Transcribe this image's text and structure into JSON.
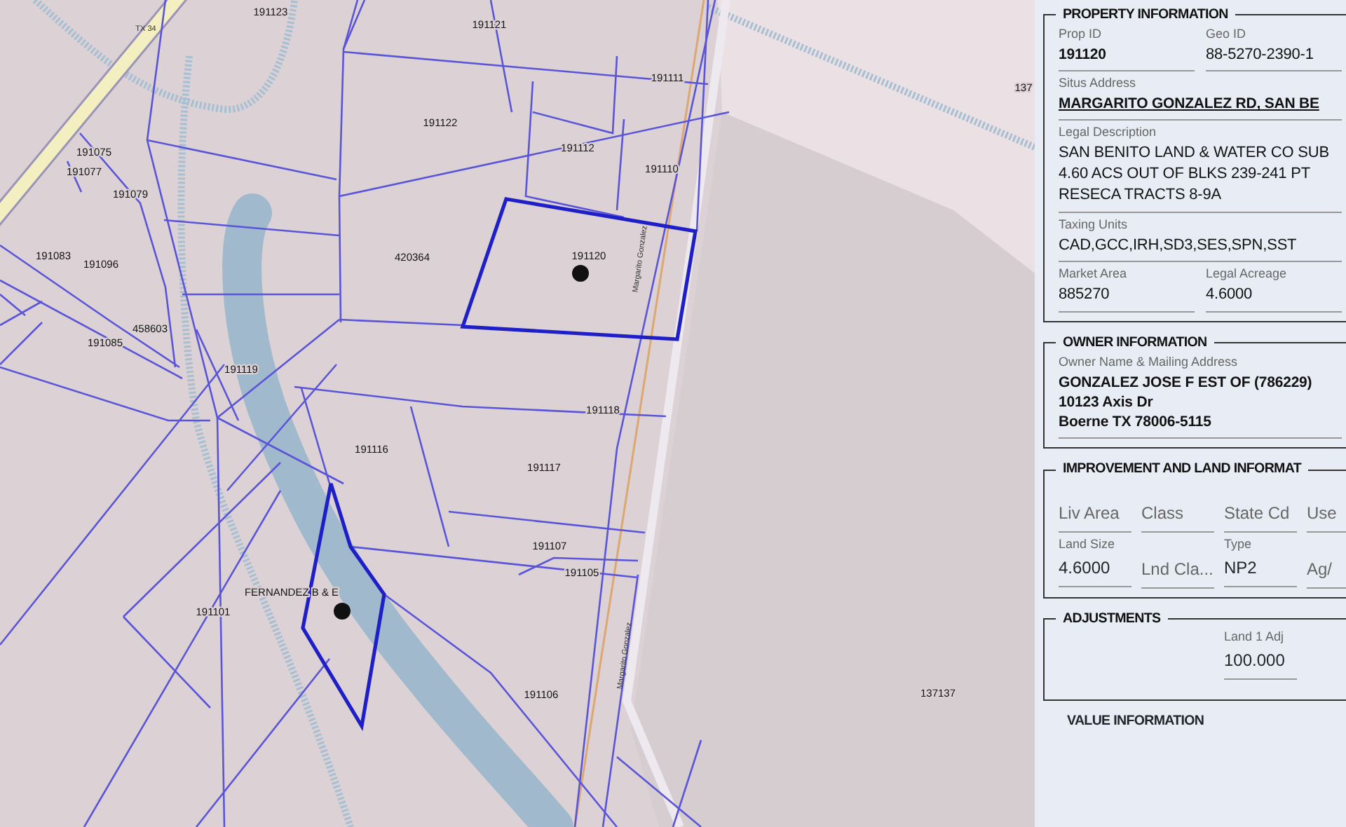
{
  "map": {
    "road_labels": [
      "TX 34",
      "Margarito Gonzalez",
      "Margarito Gonzalez"
    ],
    "parcel_labels": [
      "191123",
      "191121",
      "191111",
      "137",
      "191075",
      "191122",
      "191077",
      "191112",
      "191079",
      "191110",
      "191083",
      "191096",
      "420364",
      "191120",
      "458603",
      "191085",
      "191119",
      "191118",
      "191116",
      "191117",
      "191107",
      "191105",
      "FERNANDEZ B & E",
      "191101",
      "191106",
      "137137"
    ]
  },
  "panel": {
    "sections": [
      {
        "kind": "fields",
        "title": "PROPERTY INFORMATION",
        "rows": [
          [
            {
              "label": "Prop ID",
              "value": "191120"
            },
            {
              "label": "Geo ID",
              "value": "88-5270-2390-1"
            }
          ],
          [
            {
              "label": "Situs Address",
              "value": "MARGARITO GONZALEZ RD, SAN BE"
            }
          ],
          [
            {
              "label": "Legal Description",
              "lines": [
                "SAN BENITO LAND & WATER CO SUB",
                "4.60 ACS OUT OF BLKS 239-241 PT",
                "RESECA TRACTS 8-9A"
              ]
            }
          ],
          [
            {
              "label": "Taxing Units",
              "value": "CAD,GCC,IRH,SD3,SES,SPN,SST"
            }
          ],
          [
            {
              "label": "Market Area",
              "value": "885270"
            },
            {
              "label": "Legal Acreage",
              "value": "4.6000"
            }
          ]
        ]
      },
      {
        "kind": "fields",
        "title": "OWNER INFORMATION",
        "rows": [
          [
            {
              "label": "Owner Name & Mailing Address",
              "lines": [
                "GONZALEZ JOSE F EST OF (786229)",
                "10123 Axis Dr",
                "Boerne TX 78006-5115"
              ]
            }
          ]
        ]
      },
      {
        "kind": "grid",
        "title": "IMPROVEMENT AND LAND INFORMAT",
        "rows": [
          [
            {
              "placeholder": "Liv Area"
            },
            {
              "placeholder": "Class"
            },
            {
              "placeholder": "State Cd"
            },
            {
              "placeholder": "Use"
            }
          ],
          [
            {
              "label": "Land Size",
              "value": "4.6000"
            },
            {
              "placeholder": "Lnd Cla..."
            },
            {
              "label": "Type",
              "value": "NP2"
            },
            {
              "placeholder": "Ag/"
            }
          ]
        ]
      },
      {
        "kind": "adjust",
        "title": "ADJUSTMENTS",
        "rows": [
          [
            {
              "label": "Land 1 Adj",
              "value": "100.000"
            }
          ]
        ]
      },
      {
        "kind": "title",
        "title": "VALUE INFORMATION"
      }
    ]
  }
}
